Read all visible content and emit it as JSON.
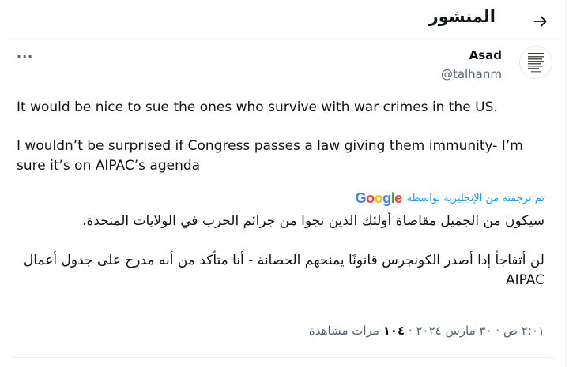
{
  "header": {
    "title": "المنشور",
    "back_icon": "arrow-right-icon"
  },
  "author": {
    "display_name": "Asad",
    "handle": "@talhanm",
    "more_label": "···"
  },
  "tweet": {
    "paragraph1": "It would be nice to sue the ones who survive with war crimes in the US.",
    "paragraph2": "I wouldn’t be surprised if Congress passes a law giving them immunity- I’m sure it’s on AIPAC’s agenda"
  },
  "translation": {
    "label": "تم ترجمته من الإنجليزية بواسطة",
    "provider": "Google",
    "paragraph1": "سيكون من الجميل مقاضاة أولئك الذين نجوا من جرائم الحرب في الولايات المتحدة.",
    "paragraph2": "لن أتفاجأ إذا أصدر الكونجرس قانونًا يمنحهم الحصانة - أنا متأكد من أنه مدرج على جدول أعمال AIPAC"
  },
  "meta": {
    "time": "٢:٠١ ص",
    "date": "٣٠ مارس ٢٠٢٤",
    "separator": "·",
    "views_count": "١٠٤",
    "views_label": "مرات مشاهدة"
  },
  "colors": {
    "accent": "#1d9bf0",
    "secondary_text": "#536471",
    "primary_text": "#0f1419"
  }
}
